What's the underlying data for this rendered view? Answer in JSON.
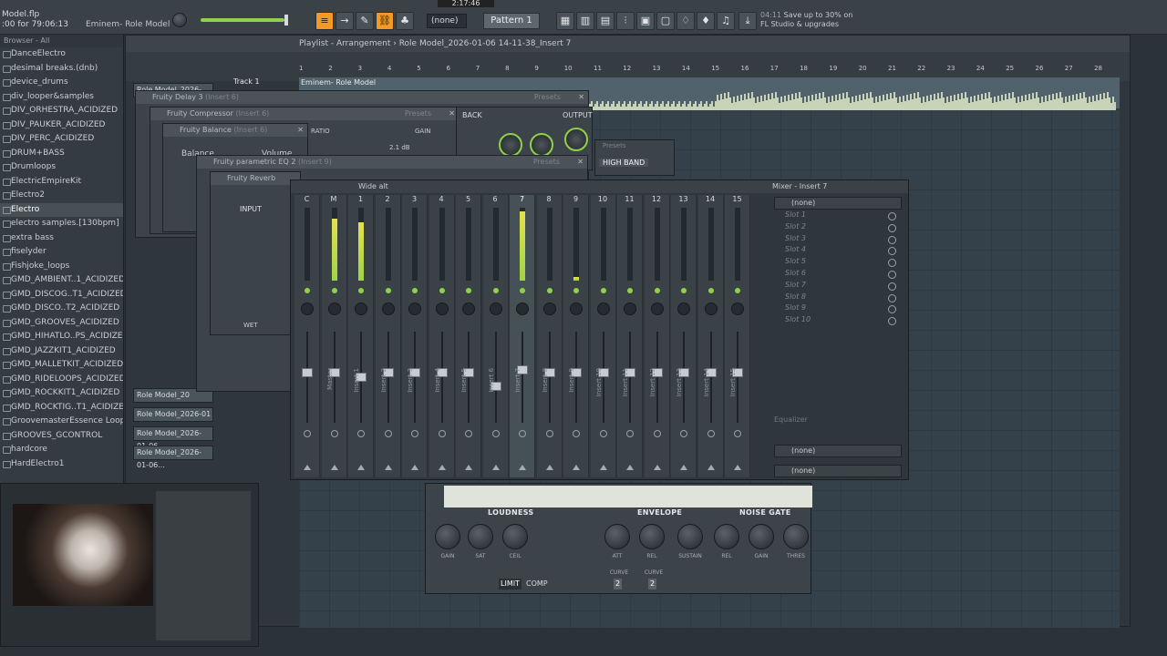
{
  "topbar": {
    "file_name": "Model.flp",
    "time_info": ":00 for 79:06:13",
    "project_label": "Eminem- Role Model",
    "clock": "2:17:46",
    "snap": "(none)",
    "pattern": "Pattern 1",
    "promo_code": "04:11",
    "promo_text": "Save up to 30% on FL Studio & upgrades"
  },
  "browser": {
    "header": "Browser - All",
    "items": [
      {
        "label": "DanceElectro"
      },
      {
        "label": "desimal breaks.(dnb)"
      },
      {
        "label": "device_drums"
      },
      {
        "label": "div_looper&samples"
      },
      {
        "label": "DIV_ORHESTRA_ACIDIZED"
      },
      {
        "label": "DIV_PAUKER_ACIDIZED"
      },
      {
        "label": "DIV_PERC_ACIDIZED"
      },
      {
        "label": "DRUM+BASS"
      },
      {
        "label": "Drumloops"
      },
      {
        "label": "ElectricEmpireKit"
      },
      {
        "label": "Electro2"
      },
      {
        "label": "Electro"
      },
      {
        "label": "electro samples.[130bpm]"
      },
      {
        "label": "extra bass"
      },
      {
        "label": "fiselyder"
      },
      {
        "label": "Fishjoke_loops"
      },
      {
        "label": "GMD_AMBIENT..1_ACIDIZED"
      },
      {
        "label": "GMD_DISCOG..T1_ACIDIZED"
      },
      {
        "label": "GMD_DISCO..T2_ACIDIZED"
      },
      {
        "label": "GMD_GROOVES_ACIDIZED"
      },
      {
        "label": "GMD_HIHATLO..PS_ACIDIZED"
      },
      {
        "label": "GMD_JAZZKIT1_ACIDIZED"
      },
      {
        "label": "GMD_MALLETKIT_ACIDIZED"
      },
      {
        "label": "GMD_RIDELOOPS_ACIDIZED"
      },
      {
        "label": "GMD_ROCKKIT1_ACIDIZED"
      },
      {
        "label": "GMD_ROCKTIG..T1_ACIDIZED"
      },
      {
        "label": "GroovemasterEssence Loops"
      },
      {
        "label": "GROOVES_GCONTROL"
      },
      {
        "label": "hardcore"
      },
      {
        "label": "HardElectro1"
      }
    ]
  },
  "playlist": {
    "title_prefix": "Playlist - Arrangement",
    "title_song": "Role Model_2026-01-06 14-11-38_Insert 7",
    "track1": "Track 1",
    "clip_label": "Eminem- Role Model",
    "clip_left": "Role Model_2026-01-06...",
    "ruler": [
      "1",
      "2",
      "3",
      "4",
      "5",
      "6",
      "7",
      "8",
      "9",
      "10",
      "11",
      "12",
      "13",
      "14",
      "15",
      "16",
      "17",
      "18",
      "19",
      "20",
      "21",
      "22",
      "23",
      "24",
      "25",
      "26",
      "27",
      "28"
    ],
    "left_clips": [
      "Role Model_2026-01-06...",
      "Role Model_20",
      "Role Model_2026-01",
      "Role Model_2026-01-06...",
      "Role Model_2026-01-06..."
    ]
  },
  "plugins": {
    "delay": {
      "title": "Fruity Delay 3",
      "insert": "(Insert 6)",
      "presets": "Presets"
    },
    "compressor": {
      "title": "Fruity Compressor",
      "insert": "(Insert 6)",
      "presets": "Presets",
      "ratio": "RATIO",
      "gain": "GAIN",
      "gain_val": "2.1 dB"
    },
    "balance": {
      "title": "Fruity Balance",
      "insert": "(Insert 6)",
      "balance": "Balance",
      "volume": "Volume"
    },
    "eq": {
      "title": "Fruity parametric EQ 2",
      "insert": "(Insert 9)",
      "presets": "Presets"
    },
    "reverb": {
      "title": "Fruity Reverb",
      "input": "INPUT",
      "wet": "WET"
    },
    "filter": {
      "back": "BACK",
      "output": "OUTPUT",
      "high_band": "HIGH BAND",
      "presets": "Presets"
    }
  },
  "mixer": {
    "title": "Wide alt",
    "insert_title": "Mixer - Insert 7",
    "strips": [
      {
        "num": "C",
        "name": "",
        "level": 0,
        "fader": 0.6
      },
      {
        "num": "M",
        "name": "Master",
        "level": 0.85,
        "fader": 0.6
      },
      {
        "num": "1",
        "name": "Insert 1",
        "level": 0.8,
        "fader": 0.55
      },
      {
        "num": "2",
        "name": "Insert 2",
        "level": 0,
        "fader": 0.6
      },
      {
        "num": "3",
        "name": "Insert 3",
        "level": 0,
        "fader": 0.6
      },
      {
        "num": "4",
        "name": "Insert 4",
        "level": 0,
        "fader": 0.6
      },
      {
        "num": "5",
        "name": "Insert 5",
        "level": 0,
        "fader": 0.6
      },
      {
        "num": "6",
        "name": "Insert 6",
        "level": 0,
        "fader": 0.45
      },
      {
        "num": "7",
        "name": "Insert 7",
        "level": 0.95,
        "fader": 0.63
      },
      {
        "num": "8",
        "name": "Insert 8",
        "level": 0,
        "fader": 0.6
      },
      {
        "num": "9",
        "name": "Insert 9",
        "level": 0.05,
        "fader": 0.6
      },
      {
        "num": "10",
        "name": "Insert 10",
        "level": 0,
        "fader": 0.6
      },
      {
        "num": "11",
        "name": "Insert 11",
        "level": 0,
        "fader": 0.6
      },
      {
        "num": "12",
        "name": "Insert 12",
        "level": 0,
        "fader": 0.6
      },
      {
        "num": "13",
        "name": "Insert 13",
        "level": 0,
        "fader": 0.6
      },
      {
        "num": "14",
        "name": "Insert 14",
        "level": 0,
        "fader": 0.6
      },
      {
        "num": "15",
        "name": "Insert 15",
        "level": 0,
        "fader": 0.6
      }
    ],
    "slot_select": "(none)",
    "slots": [
      "Slot 1",
      "Slot 2",
      "Slot 3",
      "Slot 4",
      "Slot 5",
      "Slot 6",
      "Slot 7",
      "Slot 8",
      "Slot 9",
      "Slot 10"
    ],
    "equalizer": "Equalizer",
    "out_a": "(none)",
    "out_b": "(none)"
  },
  "limiter": {
    "sections": {
      "loudness": "LOUDNESS",
      "envelope": "ENVELOPE",
      "noise_gate": "NOISE GATE"
    },
    "knobs": [
      "GAIN",
      "SAT",
      "CEIL",
      "ATT",
      "REL",
      "SUSTAIN",
      "REL",
      "GAIN",
      "THRES"
    ],
    "curve_label": "CURVE",
    "curve1": "2",
    "curve2": "2",
    "limit": "LIMIT",
    "comp": "COMP"
  }
}
